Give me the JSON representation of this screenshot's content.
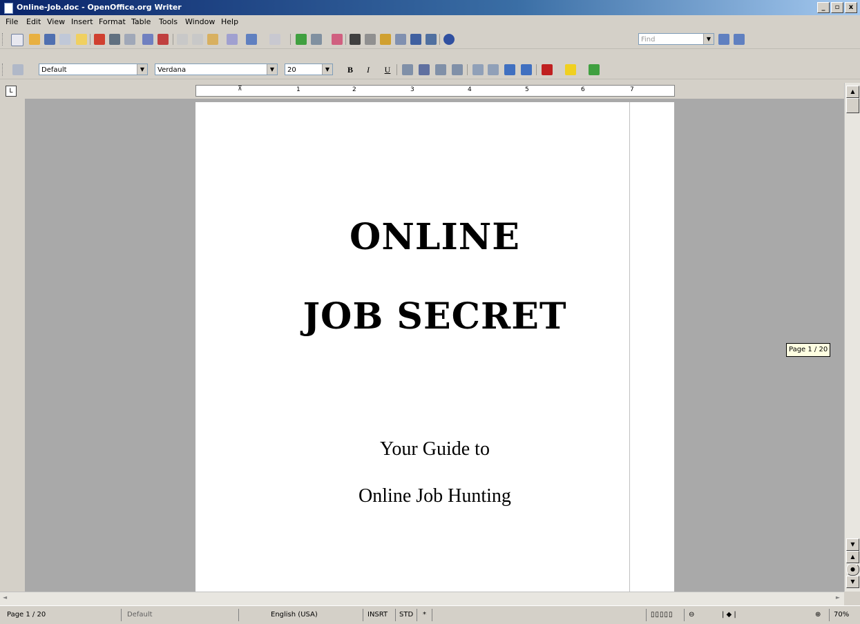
{
  "window": {
    "title": "Online-Job.doc - OpenOffice.org Writer",
    "buttons": [
      "_",
      "▫",
      "x"
    ]
  },
  "menu": [
    "File",
    "Edit",
    "View",
    "Insert",
    "Format",
    "Table",
    "Tools",
    "Window",
    "Help"
  ],
  "toolbar": {
    "find_placeholder": "Find"
  },
  "formatting": {
    "style": "Default",
    "font": "Verdana",
    "size": "20",
    "bold": "B",
    "italic": "I",
    "underline": "U"
  },
  "ruler": {
    "ticks": [
      "1",
      "2",
      "3",
      "4",
      "5",
      "6",
      "7"
    ]
  },
  "document": {
    "title_line1": "ONLINE",
    "title_line2": "JOB SECRET",
    "subtitle_line1": "Your Guide to",
    "subtitle_line2": "Online Job Hunting"
  },
  "tooltip": "Page 1 / 20",
  "status": {
    "page": "Page 1 / 20",
    "style": "Default",
    "language": "English (USA)",
    "insert": "INSRT",
    "selection": "STD",
    "modified": "*",
    "zoom": "70%"
  }
}
